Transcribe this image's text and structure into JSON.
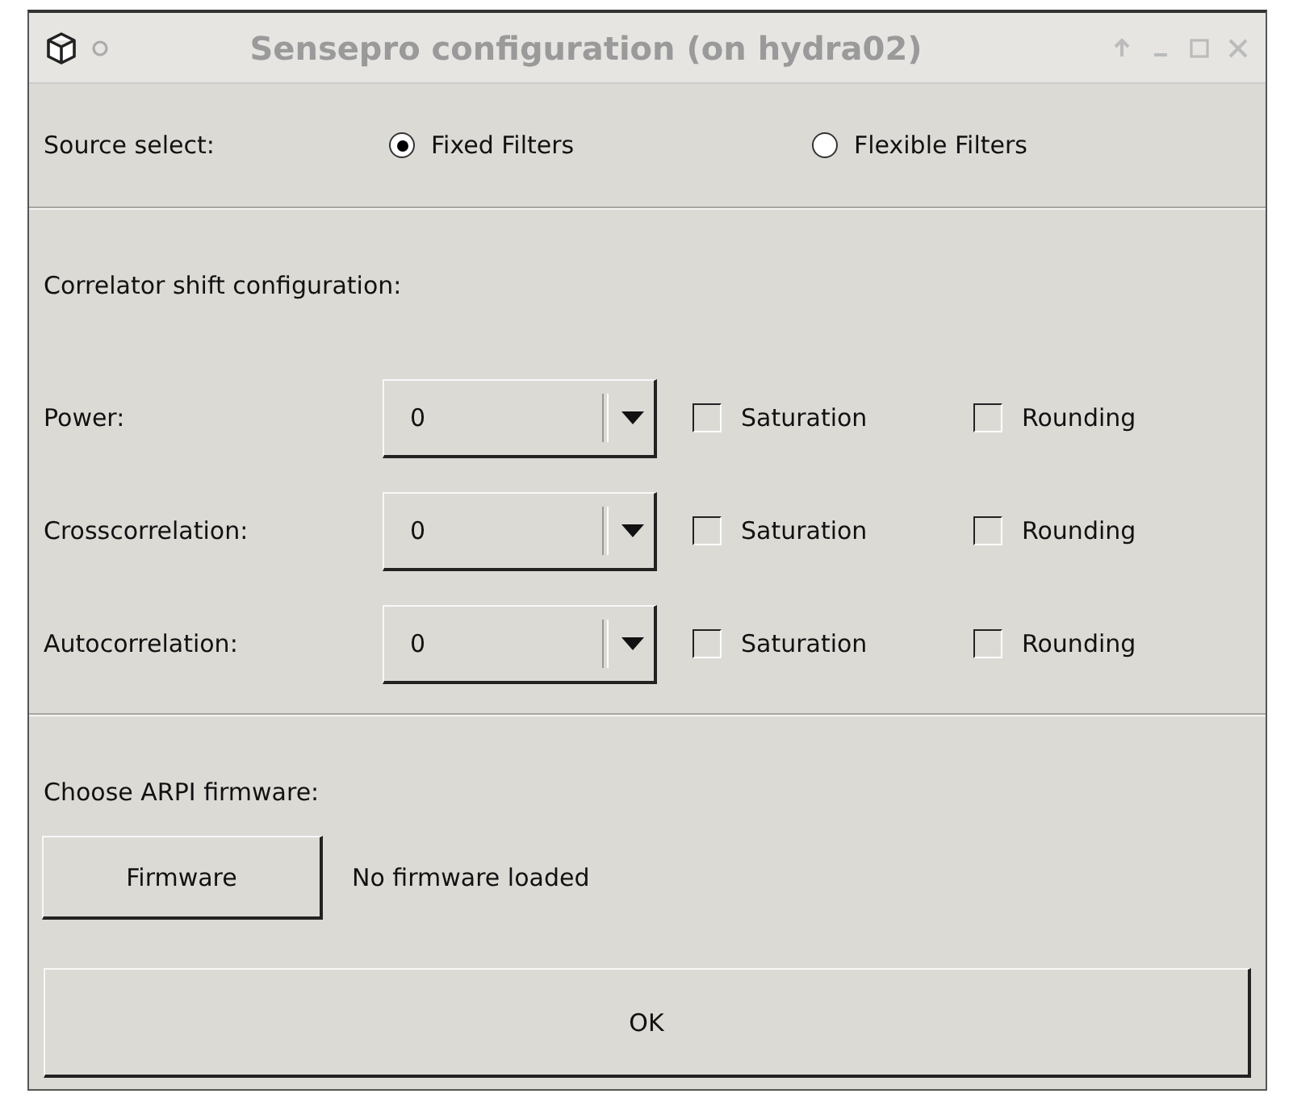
{
  "window": {
    "title": "Sensepro configuration (on hydra02)"
  },
  "source_select": {
    "label": "Source select:",
    "options": [
      {
        "label": "Fixed Filters",
        "selected": true
      },
      {
        "label": "Flexible Filters",
        "selected": false
      }
    ]
  },
  "correlator": {
    "heading": "Correlator shift configuration:",
    "rows": [
      {
        "label": "Power:",
        "value": "0",
        "saturation": {
          "label": "Saturation",
          "checked": false
        },
        "rounding": {
          "label": "Rounding",
          "checked": false
        }
      },
      {
        "label": "Crosscorrelation:",
        "value": "0",
        "saturation": {
          "label": "Saturation",
          "checked": false
        },
        "rounding": {
          "label": "Rounding",
          "checked": false
        }
      },
      {
        "label": "Autocorrelation:",
        "value": "0",
        "saturation": {
          "label": "Saturation",
          "checked": false
        },
        "rounding": {
          "label": "Rounding",
          "checked": false
        }
      }
    ]
  },
  "firmware": {
    "heading": "Choose ARPI firmware:",
    "button": "Firmware",
    "status": "No firmware loaded"
  },
  "ok_button": "OK"
}
